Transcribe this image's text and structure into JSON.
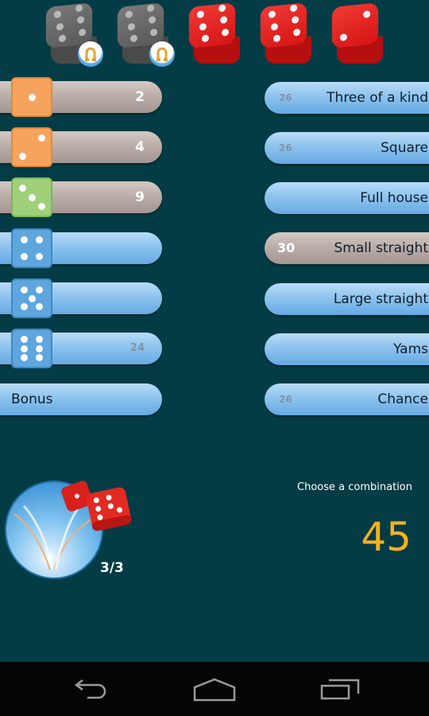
{
  "dice": [
    {
      "value": 6,
      "color": "gray",
      "locked": true
    },
    {
      "value": 6,
      "color": "gray",
      "locked": true
    },
    {
      "value": 6,
      "color": "red",
      "locked": false
    },
    {
      "value": 6,
      "color": "red",
      "locked": false
    },
    {
      "value": 2,
      "color": "red",
      "locked": false
    }
  ],
  "upper_section": [
    {
      "face": 1,
      "score": "2",
      "state": "filled"
    },
    {
      "face": 2,
      "score": "4",
      "state": "filled"
    },
    {
      "face": 3,
      "score": "9",
      "state": "filled"
    },
    {
      "face": 4,
      "score": "",
      "state": "open"
    },
    {
      "face": 5,
      "score": "",
      "state": "open"
    },
    {
      "face": 6,
      "score": "24",
      "state": "potential"
    }
  ],
  "bonus": {
    "label": "Bonus"
  },
  "lower_section": [
    {
      "label": "Three of a kind",
      "score": "26",
      "state": "potential"
    },
    {
      "label": "Square",
      "score": "26",
      "state": "potential"
    },
    {
      "label": "Full house",
      "score": "",
      "state": "open"
    },
    {
      "label": "Small straight",
      "score": "30",
      "state": "filled"
    },
    {
      "label": "Large straight",
      "score": "",
      "state": "open"
    },
    {
      "label": "Yams",
      "score": "",
      "state": "open"
    },
    {
      "label": "Chance",
      "score": "26",
      "state": "potential"
    }
  ],
  "roll": {
    "count": "3/3"
  },
  "status": {
    "message": "Choose a combination",
    "total": "45"
  },
  "colors": {
    "background": "#033c45",
    "total": "#f5b122",
    "face_filled_orange": "#f6a45d",
    "face_filled_green": "#9fcf79",
    "face_open_blue": "#5ea6dd"
  },
  "navbar": {
    "back": "back-icon",
    "home": "home-icon",
    "recents": "recents-icon"
  }
}
